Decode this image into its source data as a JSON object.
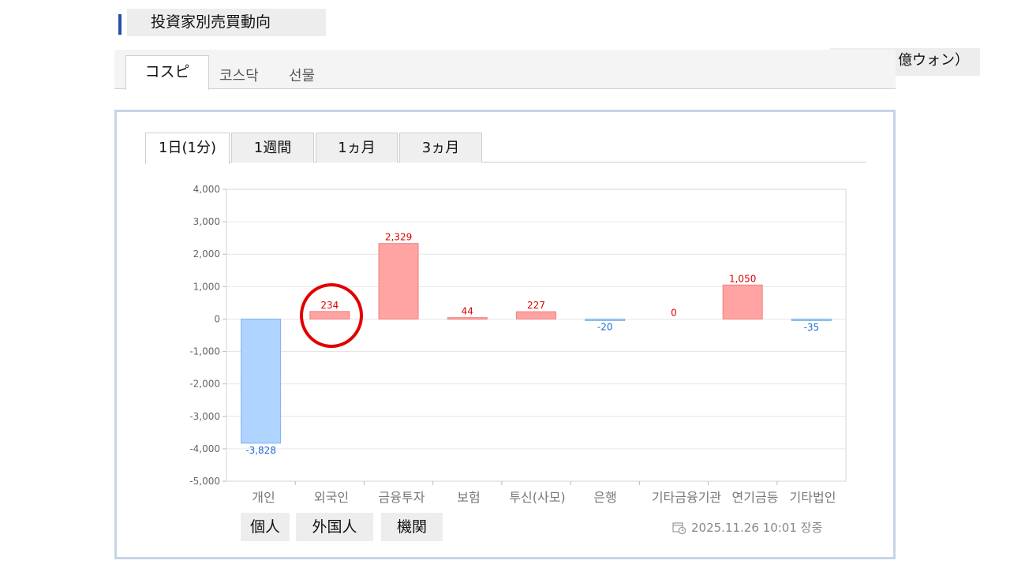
{
  "header": {
    "title": "投資家別売買動向",
    "unit": "（単位：億ウォン）"
  },
  "market_tabs": [
    {
      "label": "コスピ",
      "active": true
    },
    {
      "label": "코스닥",
      "active": false
    },
    {
      "label": "선물",
      "active": false
    }
  ],
  "period_tabs": [
    {
      "label": "1日(1分)",
      "active": true
    },
    {
      "label": "1週間",
      "active": false
    },
    {
      "label": "1ヵ月",
      "active": false
    },
    {
      "label": "3ヵ月",
      "active": false
    }
  ],
  "investor_labels": [
    "個人",
    "外国人",
    "機関"
  ],
  "timestamp": "2025.11.26 10:01 장중",
  "colors": {
    "positive": "#ffa3a3",
    "negative": "#aed4ff",
    "positive_text": "#e00000",
    "negative_text": "#1a6bd6"
  },
  "chart_data": {
    "type": "bar",
    "categories": [
      "개인",
      "외국인",
      "금융투자",
      "보험",
      "투신(사모)",
      "은행",
      "기타금융",
      "기관",
      "연기금등",
      "기타법인"
    ],
    "category_labels": [
      "개인",
      "외국인",
      "금융투자",
      "보험",
      "투신(사모)",
      "은행",
      "기타금융기관",
      "연기금등",
      "기타법인"
    ],
    "values": [
      -3828,
      234,
      2329,
      44,
      227,
      -20,
      0,
      1050,
      -35
    ],
    "value_labels": [
      "-3,828",
      "234",
      "2,329",
      "44",
      "227",
      "-20",
      "0",
      "1,050",
      "-35"
    ],
    "ylim": [
      -5000,
      4000
    ],
    "yticks": [
      4000,
      3000,
      2000,
      1000,
      0,
      -1000,
      -2000,
      -3000,
      -4000,
      -5000
    ],
    "ytick_labels": [
      "4,000",
      "3,000",
      "2,000",
      "1,000",
      "0",
      "-1,000",
      "-2,000",
      "-3,000",
      "-4,000",
      "-5,000"
    ],
    "grid": true
  }
}
